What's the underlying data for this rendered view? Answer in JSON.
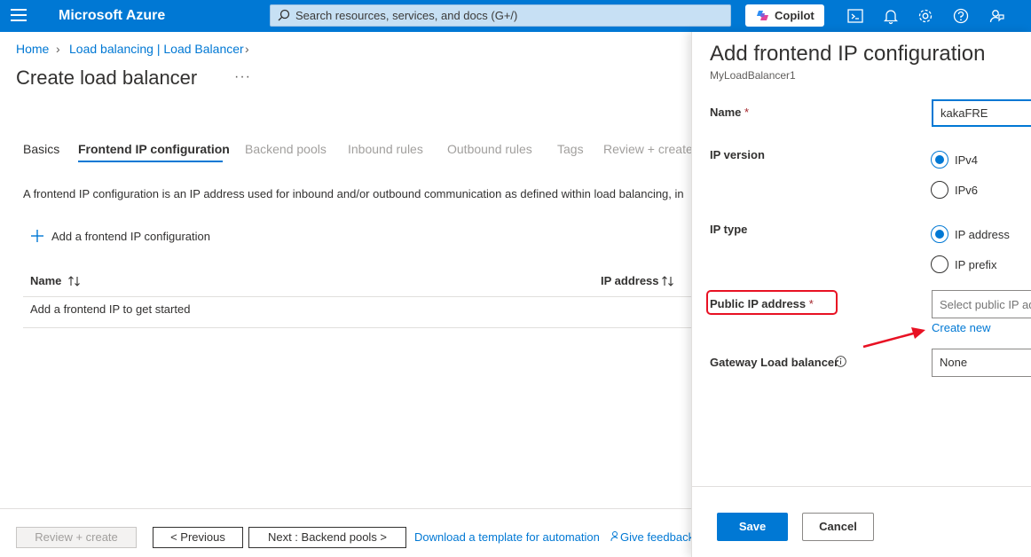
{
  "topbar": {
    "brand": "Microsoft Azure",
    "search_placeholder": "Search resources, services, and docs (G+/)",
    "copilot_label": "Copilot",
    "icons": [
      "menu-icon",
      "search-icon",
      "copilot-icon",
      "cloud-shell-icon",
      "notifications-icon",
      "settings-icon",
      "help-icon",
      "feedback-icon"
    ]
  },
  "breadcrumb": {
    "items": [
      "Home",
      "Load balancing | Load Balancer"
    ]
  },
  "page": {
    "title": "Create load balancer",
    "more": "···"
  },
  "tabs": [
    {
      "label": "Basics",
      "state": "done"
    },
    {
      "label": "Frontend IP configuration",
      "state": "active"
    },
    {
      "label": "Backend pools",
      "state": "disabled"
    },
    {
      "label": "Inbound rules",
      "state": "disabled"
    },
    {
      "label": "Outbound rules",
      "state": "disabled"
    },
    {
      "label": "Tags",
      "state": "disabled"
    },
    {
      "label": "Review + create",
      "state": "disabled"
    }
  ],
  "main": {
    "description": "A frontend IP configuration is an IP address used for inbound and/or outbound communication as defined within load balancing, in",
    "add_label": "Add a frontend IP configuration",
    "table": {
      "headers": [
        "Name",
        "IP address"
      ],
      "empty_text": "Add a frontend IP to get started"
    }
  },
  "footer": {
    "review_create": "Review + create",
    "previous": "< Previous",
    "next": "Next : Backend pools >",
    "download_template": "Download a template for automation",
    "feedback": "Give feedback"
  },
  "panel": {
    "title": "Add frontend IP configuration",
    "subtitle": "MyLoadBalancer1",
    "name_label": "Name",
    "name_value": "kakaFRE",
    "required_mark": "*",
    "ip_version_label": "IP version",
    "ip_version_options": [
      "IPv4",
      "IPv6"
    ],
    "ip_version_selected": "IPv4",
    "ip_type_label": "IP type",
    "ip_type_options": [
      "IP address",
      "IP prefix"
    ],
    "ip_type_selected": "IP address",
    "public_ip_label": "Public IP address",
    "public_ip_placeholder": "Select public IP address",
    "create_new": "Create new",
    "gateway_label": "Gateway Load balancer",
    "gateway_value": "None",
    "save": "Save",
    "cancel": "Cancel"
  },
  "colors": {
    "accent": "#0078d4",
    "topbar": "#0078d4",
    "annotation": "#e81123"
  }
}
